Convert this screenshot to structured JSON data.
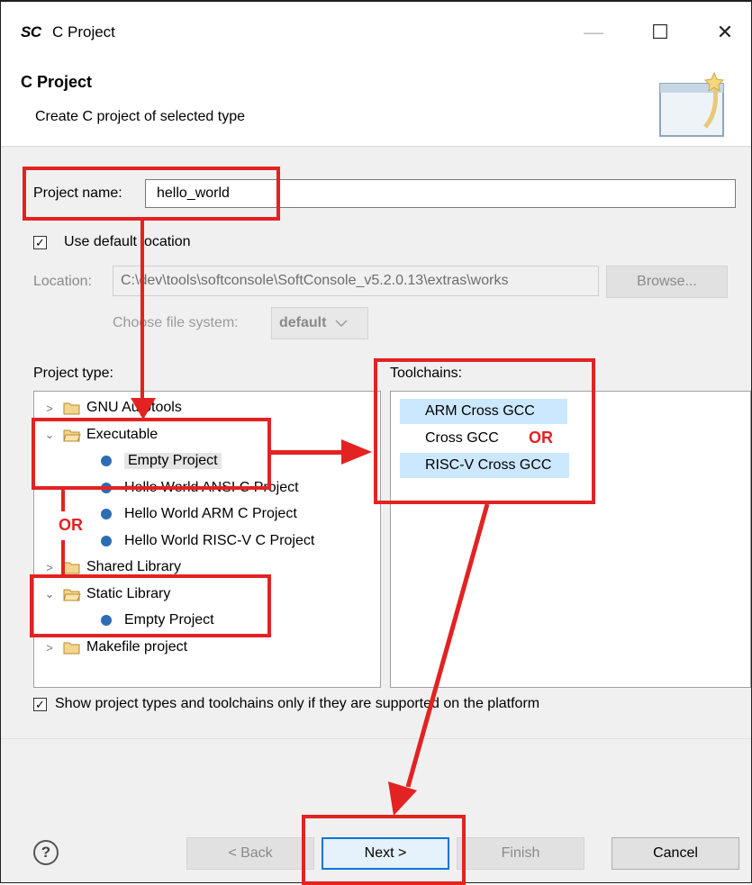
{
  "titlebar": {
    "logo": "SC",
    "title": "C Project",
    "minimize_glyph": "—",
    "maximize_glyph": "☐",
    "close_glyph": "✕"
  },
  "header": {
    "title": "C Project",
    "description": "Create C project of selected type",
    "icon": "wizard-banner-icon"
  },
  "form": {
    "project_name_label": "Project name:",
    "project_name_value": "hello_world",
    "use_default_label": "Use default location",
    "use_default_checked": true,
    "location_label": "Location:",
    "location_value": "C:\\dev\\tools\\softconsole\\SoftConsole_v5.2.0.13\\extras\\works",
    "browse_label": "Browse...",
    "filesystem_label": "Choose file system:",
    "filesystem_value": "default"
  },
  "project_type": {
    "label": "Project type:",
    "items": [
      {
        "label": "GNU Autotools",
        "kind": "folder",
        "expanded": false
      },
      {
        "label": "Executable",
        "kind": "folder",
        "expanded": true
      },
      {
        "label": "Empty Project",
        "kind": "leaf",
        "selected": true
      },
      {
        "label": "Hello World ANSI C Project",
        "kind": "leaf"
      },
      {
        "label": "Hello World ARM C Project",
        "kind": "leaf"
      },
      {
        "label": "Hello World RISC-V C Project",
        "kind": "leaf"
      },
      {
        "label": "Shared Library",
        "kind": "folder",
        "expanded": false
      },
      {
        "label": "Static Library",
        "kind": "folder",
        "expanded": true
      },
      {
        "label": "Empty Project",
        "kind": "leaf"
      },
      {
        "label": "Makefile project",
        "kind": "folder",
        "expanded": false
      }
    ]
  },
  "toolchains": {
    "label": "Toolchains:",
    "items": [
      {
        "label": "ARM Cross GCC",
        "selected": true
      },
      {
        "label": "Cross GCC",
        "selected": false
      },
      {
        "label": "RISC-V Cross GCC",
        "selected": true
      }
    ]
  },
  "show_supported": {
    "label": "Show project types and toolchains only if they are supported on the platform",
    "checked": true
  },
  "buttons": {
    "help": "?",
    "back": "< Back",
    "next": "Next >",
    "finish": "Finish",
    "cancel": "Cancel"
  },
  "annotations": {
    "or_1": "OR",
    "or_2": "OR",
    "color": "#e32222"
  },
  "colors": {
    "selection": "#cce8ff",
    "accent": "#0078d7",
    "tree_bullet": "#2c6db3"
  }
}
